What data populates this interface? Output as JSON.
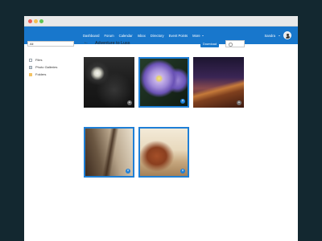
{
  "nav": {
    "links": [
      "Dashboard",
      "Forum",
      "Calendar",
      "Inbox",
      "Directory",
      "Event Points"
    ],
    "more_label": "More",
    "user_name": "Sandra"
  },
  "sidebar": {
    "filter_value": "All",
    "items": [
      {
        "label": "Files",
        "icon": "file-icon"
      },
      {
        "label": "Photo Galleries",
        "icon": "gallery-icon"
      },
      {
        "label": "Folders",
        "icon": "folder-icon"
      }
    ]
  },
  "main": {
    "title": "Adventure to Luss",
    "download_label": "Download",
    "search_placeholder": "",
    "tiles": [
      {
        "subject": "night street with lamp post",
        "selected": false,
        "badge": "+"
      },
      {
        "subject": "purple petunia flowers",
        "selected": true,
        "badge": "×"
      },
      {
        "subject": "desert dunes at dusk",
        "selected": false,
        "badge": "+"
      },
      {
        "subject": "bicycles along a street",
        "selected": true,
        "badge": "×"
      },
      {
        "subject": "highland cow",
        "selected": true,
        "badge": "×"
      }
    ]
  },
  "colors": {
    "brand": "#1877cc",
    "selection": "#1e7fd6",
    "background": "#132830"
  }
}
